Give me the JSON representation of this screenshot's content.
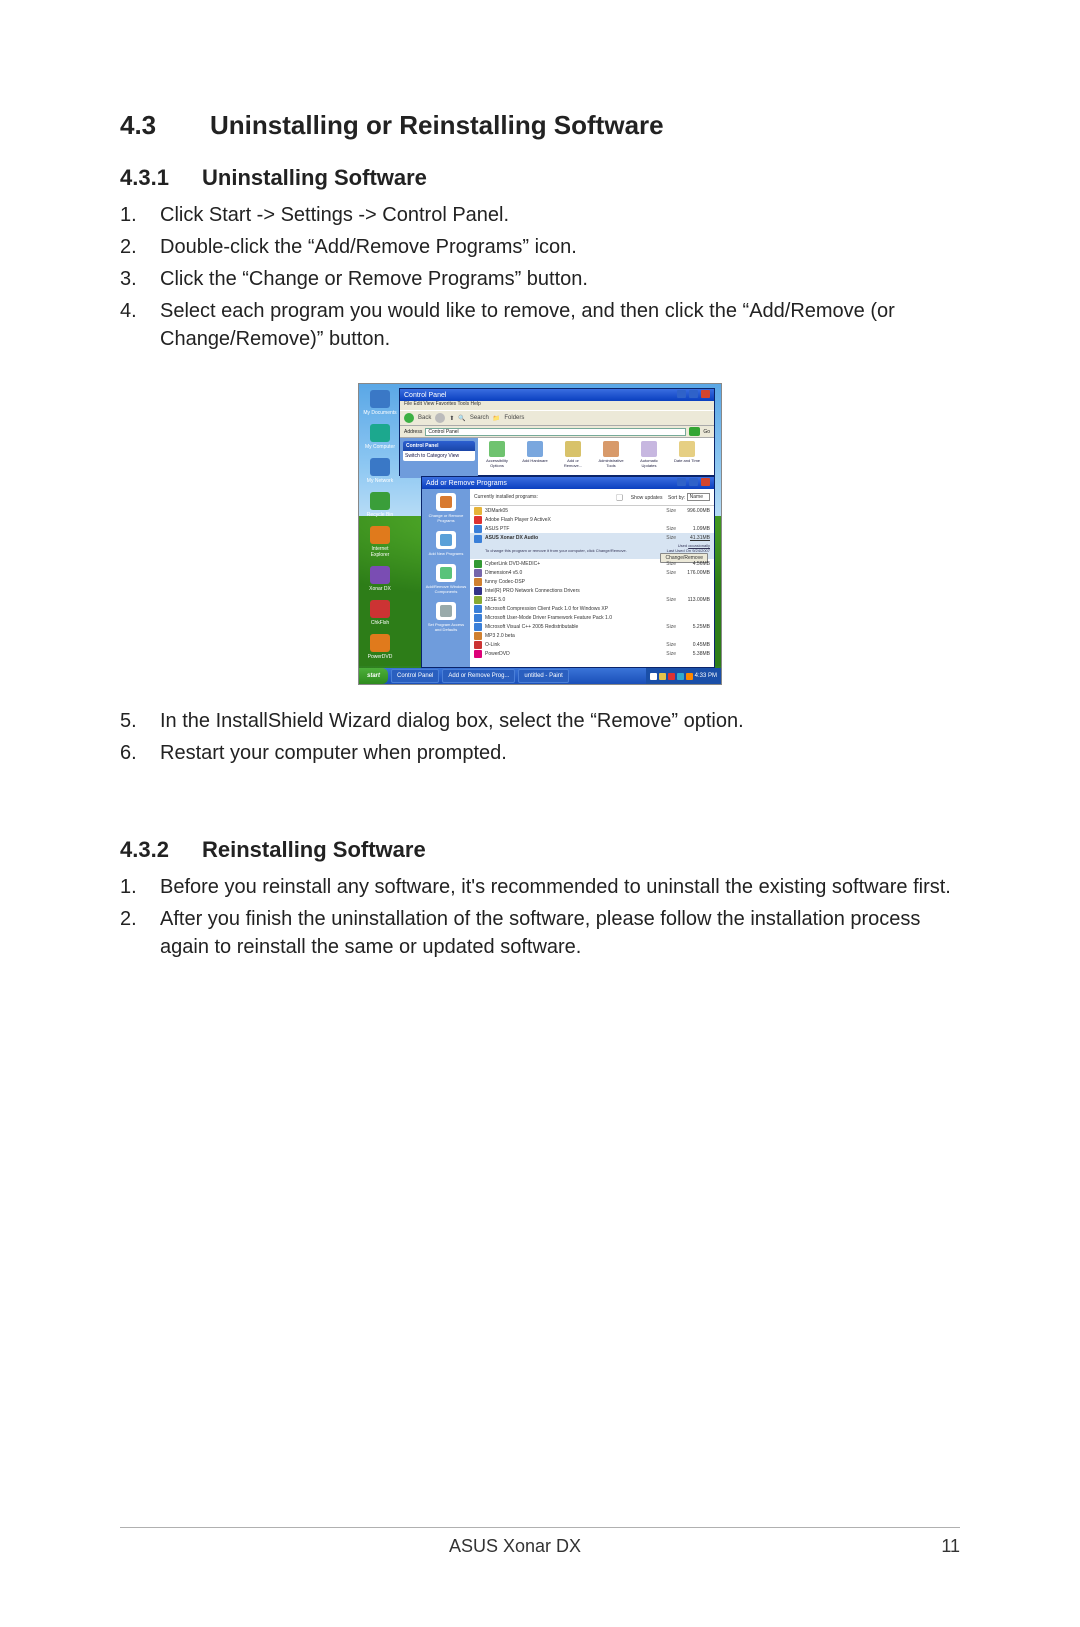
{
  "section": {
    "num": "4.3",
    "title": "Uninstalling or Reinstalling Software"
  },
  "sub1": {
    "num": "4.3.1",
    "title": "Uninstalling Software",
    "steps": [
      "Click Start -> Settings -> Control Panel.",
      "Double-click the “Add/Remove Programs” icon.",
      "Click the “Change or Remove Programs” button.",
      "Select each program you would like to remove, and then click the “Add/Remove (or Change/Remove)” button.",
      "In the InstallShield Wizard dialog box, select the “Remove” option.",
      "Restart your computer when prompted."
    ]
  },
  "sub2": {
    "num": "4.3.2",
    "title": "Reinstalling Software",
    "steps": [
      "Before you reinstall any software, it's recommended to uninstall the existing software first.",
      "After you finish the uninstallation of the software, please follow the installation process again to reinstall the same or updated software."
    ]
  },
  "footer": {
    "product": "ASUS Xonar DX",
    "page": "11"
  },
  "screenshot": {
    "desktop_icons": [
      "My Documents",
      "My Computer",
      "My Network",
      "Recycle Bin",
      "Internet Explorer",
      "Xonar DX",
      "ChkFlsh",
      "PowerDVD"
    ],
    "cp_window": {
      "title": "Control Panel",
      "menu": "File   Edit   View   Favorites   Tools   Help",
      "toolbar": {
        "back": "Back",
        "search": "Search",
        "folders": "Folders"
      },
      "address_label": "Address",
      "address_value": "Control Panel",
      "go": "Go",
      "side": {
        "header": "Control Panel",
        "link": "Switch to Category View"
      },
      "icons": [
        "Accessibility Options",
        "Add Hardware",
        "Add or Remove...",
        "Administrative Tools",
        "Automatic Updates",
        "Date and Time"
      ]
    },
    "arp_window": {
      "title": "Add or Remove Programs",
      "side": [
        "Change or Remove Programs",
        "Add New Programs",
        "Add/Remove Windows Components",
        "Set Program Access and Defaults"
      ],
      "top_label": "Currently installed programs:",
      "show_updates": "Show updates",
      "sort_label": "Sort by:",
      "sort_value": "Name",
      "size_label": "Size",
      "selected": {
        "name": "ASUS Xonar DX Audio",
        "size": "41.31MB",
        "used_label": "Used",
        "used_value": "occasionally",
        "last_label": "Last Used On",
        "last_value": "9/24/2007",
        "hint": "To change this program or remove it from your computer, click Change/Remove.",
        "button": "Change/Remove"
      },
      "rows": [
        {
          "name": "3DMark05",
          "size": "996.00MB"
        },
        {
          "name": "Adobe Flash Player 9 ActiveX",
          "size": ""
        },
        {
          "name": "ASUS PTF",
          "size": "1.09MB"
        },
        {
          "name": "CyberLink DVD-MEDIC+",
          "size": "4.56MB"
        },
        {
          "name": "Dimension4 v5.0",
          "size": "176.00MB"
        },
        {
          "name": "funny Codec-DSP",
          "size": ""
        },
        {
          "name": "Intel(R) PRO Network Connections Drivers",
          "size": ""
        },
        {
          "name": "J2SE 5.0",
          "size": "113.00MB"
        },
        {
          "name": "Microsoft Compression Client Pack 1.0 for Windows XP",
          "size": ""
        },
        {
          "name": "Microsoft User-Mode Driver Framework Feature Pack 1.0",
          "size": ""
        },
        {
          "name": "Microsoft Visual C++ 2005 Redistributable",
          "size": "5.25MB"
        },
        {
          "name": "MP3 2.0 beta",
          "size": ""
        },
        {
          "name": "O-Link",
          "size": "0.45MB"
        },
        {
          "name": "PowerDVD",
          "size": "5.38MB"
        }
      ]
    },
    "taskbar": {
      "start": "start",
      "buttons": [
        "Control Panel",
        "Add or Remove Prog...",
        "untitled - Paint"
      ],
      "time": "4:33 PM"
    }
  }
}
